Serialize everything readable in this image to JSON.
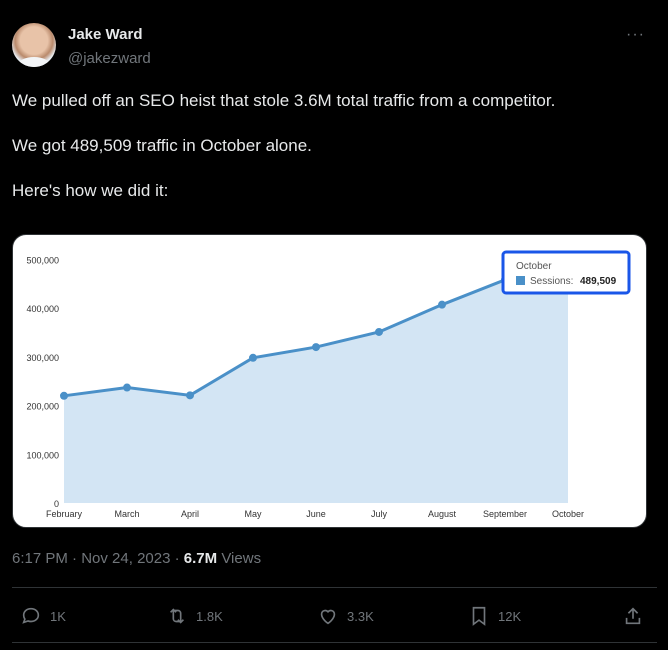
{
  "author": {
    "name": "Jake Ward",
    "handle": "@jakezward"
  },
  "more_icon": "more-horizontal-icon",
  "tweet": {
    "line1": "We pulled off an SEO heist that stole 3.6M total traffic from a competitor.",
    "line2": "We got 489,509 traffic in October alone.",
    "line3": "Here's how we did it:"
  },
  "meta": {
    "time": "6:17 PM",
    "separator": "·",
    "date": "Nov 24, 2023",
    "views_count": "6.7M",
    "views_label": "Views"
  },
  "actions": {
    "reply": "1K",
    "retweet": "1.8K",
    "like": "3.3K",
    "bookmark": "12K"
  },
  "colors": {
    "line": "#4a90c8",
    "fill": "#d3e5f4",
    "tooltip_border": "#1a56e8",
    "swatch": "#4a90c8"
  },
  "chart_data": {
    "type": "area",
    "categories": [
      "February",
      "March",
      "April",
      "May",
      "June",
      "July",
      "August",
      "September",
      "October"
    ],
    "series": [
      {
        "name": "Sessions",
        "values": [
          220000,
          237000,
          221000,
          298000,
          320000,
          351000,
          407000,
          458000,
          489509
        ]
      }
    ],
    "ylim": [
      0,
      550000
    ],
    "yticks": [
      "0",
      "100,000",
      "200,000",
      "300,000",
      "400,000",
      "500,000"
    ],
    "grid": false,
    "tooltip": {
      "title": "October",
      "series_label": "Sessions:",
      "value": "489,509"
    }
  }
}
